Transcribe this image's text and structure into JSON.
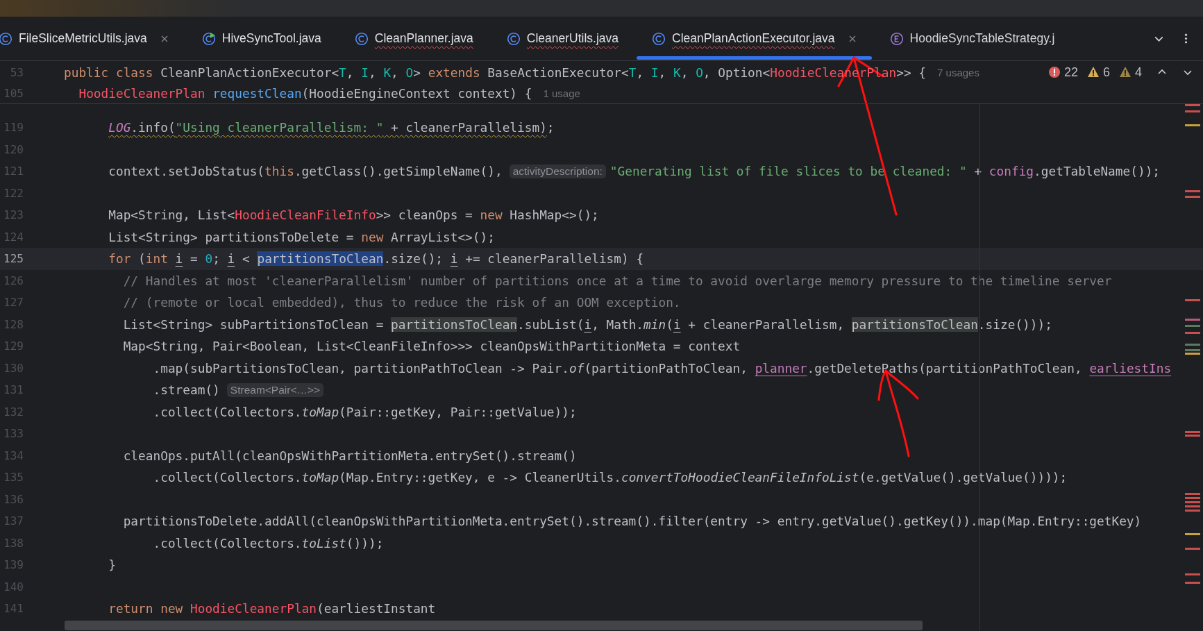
{
  "tabs": [
    {
      "label": "FileSliceMetricUtils.java",
      "kind": "class",
      "selected": false,
      "error": false,
      "closable": true
    },
    {
      "label": "HiveSyncTool.java",
      "kind": "runnable",
      "selected": false,
      "error": false,
      "closable": false
    },
    {
      "label": "CleanPlanner.java",
      "kind": "class",
      "selected": false,
      "error": true,
      "closable": false
    },
    {
      "label": "CleanerUtils.java",
      "kind": "class",
      "selected": false,
      "error": true,
      "closable": false
    },
    {
      "label": "CleanPlanActionExecutor.java",
      "kind": "class",
      "selected": true,
      "error": true,
      "closable": true
    },
    {
      "label": "HoodieSyncTableStrategy.j",
      "kind": "enum",
      "selected": false,
      "error": false,
      "closable": false
    }
  ],
  "inspections": [
    {
      "kind": "error",
      "count": "22"
    },
    {
      "kind": "warning",
      "count": "6"
    },
    {
      "kind": "weak",
      "count": "4"
    }
  ],
  "sticky": [
    {
      "n": "53",
      "parts": [
        {
          "kind": "code",
          "tokens": [
            {
              "t": "public class",
              "kind": "keyword"
            },
            {
              "t": " CleanPlanActionExecutor<",
              "kind": "plain"
            },
            {
              "t": "T",
              "kind": "typeparam"
            },
            {
              "t": ", ",
              "kind": "plain"
            },
            {
              "t": "I",
              "kind": "typeparam"
            },
            {
              "t": ", ",
              "kind": "plain"
            },
            {
              "t": "K",
              "kind": "typeparam"
            },
            {
              "t": ", ",
              "kind": "plain"
            },
            {
              "t": "O",
              "kind": "typeparam"
            },
            {
              "t": "> ",
              "kind": "plain"
            },
            {
              "t": "extends",
              "kind": "keyword"
            },
            {
              "t": " BaseActionExecutor<",
              "kind": "plain"
            },
            {
              "t": "T",
              "kind": "typeparam"
            },
            {
              "t": ", ",
              "kind": "plain"
            },
            {
              "t": "I",
              "kind": "typeparam"
            },
            {
              "t": ", ",
              "kind": "plain"
            },
            {
              "t": "K",
              "kind": "typeparam"
            },
            {
              "t": ", ",
              "kind": "plain"
            },
            {
              "t": "O",
              "kind": "typeparam"
            },
            {
              "t": ", Option<",
              "kind": "plain"
            },
            {
              "t": "HoodieCleanerPlan",
              "kind": "error"
            },
            {
              "t": ">> {",
              "kind": "plain"
            }
          ]
        },
        {
          "kind": "usages",
          "text": "7 usages"
        }
      ]
    },
    {
      "n": "105",
      "parts": [
        {
          "kind": "code",
          "tokens": [
            {
              "t": "  HoodieCleanerPlan",
              "kind": "error"
            },
            {
              "t": " requestClean",
              "kind": "method"
            },
            {
              "t": "(HoodieEngineContext context) {",
              "kind": "plain"
            }
          ]
        },
        {
          "kind": "usages",
          "text": "1 usage"
        }
      ]
    }
  ],
  "lines": [
    {
      "n": "119",
      "current": false,
      "parts": [
        {
          "kind": "code",
          "tokens": [
            {
              "t": "      LOG",
              "kind": "static-warn"
            },
            {
              "t": ".info(",
              "kind": "plain-warn"
            },
            {
              "t": "\"Using cleanerParallelism: \"",
              "kind": "string-warn"
            },
            {
              "t": " + cleanerParallelism)",
              "kind": "plain-warn"
            },
            {
              "t": ";",
              "kind": "plain"
            }
          ]
        }
      ]
    },
    {
      "n": "120",
      "current": false
    },
    {
      "n": "121",
      "current": false,
      "parts": [
        {
          "kind": "code",
          "tokens": [
            {
              "t": "      context.setJobStatus(",
              "kind": "plain"
            },
            {
              "t": "this",
              "kind": "keyword"
            },
            {
              "t": ".getClass().getSimpleName(),",
              "kind": "plain"
            }
          ]
        },
        {
          "kind": "inlay",
          "text": "activityDescription:"
        },
        {
          "kind": "code",
          "tokens": [
            {
              "t": "\"Generating list of file slices to be cleaned: \"",
              "kind": "string"
            },
            {
              "t": " + ",
              "kind": "plain"
            },
            {
              "t": "config",
              "kind": "field"
            },
            {
              "t": ".getTableName());",
              "kind": "plain"
            }
          ]
        }
      ]
    },
    {
      "n": "122",
      "current": false
    },
    {
      "n": "123",
      "current": false,
      "parts": [
        {
          "kind": "code",
          "tokens": [
            {
              "t": "      Map<String, List<",
              "kind": "plain"
            },
            {
              "t": "HoodieCleanFileInfo",
              "kind": "error"
            },
            {
              "t": ">> cleanOps = ",
              "kind": "plain"
            },
            {
              "t": "new",
              "kind": "keyword"
            },
            {
              "t": " HashMap<>();",
              "kind": "plain"
            }
          ]
        }
      ]
    },
    {
      "n": "124",
      "current": false,
      "parts": [
        {
          "kind": "code",
          "tokens": [
            {
              "t": "      List<String> partitionsToDelete = ",
              "kind": "plain"
            },
            {
              "t": "new",
              "kind": "keyword"
            },
            {
              "t": " ArrayList<>();",
              "kind": "plain"
            }
          ]
        }
      ]
    },
    {
      "n": "125",
      "current": true,
      "parts": [
        {
          "kind": "code",
          "tokens": [
            {
              "t": "      for",
              "kind": "keyword"
            },
            {
              "t": " (",
              "kind": "plain"
            },
            {
              "t": "int ",
              "kind": "keyword"
            },
            {
              "t": "i",
              "kind": "var"
            },
            {
              "t": " = ",
              "kind": "plain"
            },
            {
              "t": "0",
              "kind": "number"
            },
            {
              "t": "; ",
              "kind": "plain"
            },
            {
              "t": "i",
              "kind": "var"
            },
            {
              "t": " < ",
              "kind": "plain"
            },
            {
              "t": "partitionsToClean",
              "kind": "selection"
            },
            {
              "t": ".size(); ",
              "kind": "plain"
            },
            {
              "t": "i",
              "kind": "var"
            },
            {
              "t": " += cleanerParallelism) {",
              "kind": "plain"
            }
          ]
        }
      ]
    },
    {
      "n": "126",
      "current": false,
      "parts": [
        {
          "kind": "code",
          "tokens": [
            {
              "t": "        // Handles at most 'cleanerParallelism' number of partitions once at a time to avoid overlarge memory pressure to the timeline server",
              "kind": "comment"
            }
          ]
        }
      ]
    },
    {
      "n": "127",
      "current": false,
      "parts": [
        {
          "kind": "code",
          "tokens": [
            {
              "t": "        // (remote or local embedded), thus to reduce the risk of an OOM exception.",
              "kind": "comment"
            }
          ]
        }
      ]
    },
    {
      "n": "128",
      "current": false,
      "parts": [
        {
          "kind": "code",
          "tokens": [
            {
              "t": "        List<String> subPartitionsToClean = ",
              "kind": "plain"
            },
            {
              "t": "partitionsToClean",
              "kind": "occurrence"
            },
            {
              "t": ".subList(",
              "kind": "plain"
            },
            {
              "t": "i",
              "kind": "var"
            },
            {
              "t": ", Math.",
              "kind": "plain"
            },
            {
              "t": "min",
              "kind": "italic"
            },
            {
              "t": "(",
              "kind": "plain"
            },
            {
              "t": "i",
              "kind": "var"
            },
            {
              "t": " + cleanerParallelism, ",
              "kind": "plain"
            },
            {
              "t": "partitionsToClean",
              "kind": "occurrence"
            },
            {
              "t": ".size()));",
              "kind": "plain"
            }
          ]
        }
      ]
    },
    {
      "n": "129",
      "current": false,
      "parts": [
        {
          "kind": "code",
          "tokens": [
            {
              "t": "        Map<String, Pair<Boolean, List<CleanFileInfo>>> cleanOpsWithPartitionMeta = context",
              "kind": "plain"
            }
          ]
        }
      ]
    },
    {
      "n": "130",
      "current": false,
      "parts": [
        {
          "kind": "code",
          "tokens": [
            {
              "t": "            .map(subPartitionsToClean, partitionPathToClean -> Pair.",
              "kind": "plain"
            },
            {
              "t": "of",
              "kind": "italic"
            },
            {
              "t": "(partitionPathToClean, ",
              "kind": "plain"
            },
            {
              "t": "planner",
              "kind": "field-link"
            },
            {
              "t": ".getDeletePaths(partitionPathToClean, ",
              "kind": "plain"
            },
            {
              "t": "earliestIns",
              "kind": "field-link"
            }
          ]
        }
      ]
    },
    {
      "n": "131",
      "current": false,
      "parts": [
        {
          "kind": "code",
          "tokens": [
            {
              "t": "            .stream()",
              "kind": "plain"
            }
          ]
        },
        {
          "kind": "inlay",
          "text": "Stream<Pair<…>>"
        }
      ]
    },
    {
      "n": "132",
      "current": false,
      "parts": [
        {
          "kind": "code",
          "tokens": [
            {
              "t": "            .collect(Collectors.",
              "kind": "plain"
            },
            {
              "t": "toMap",
              "kind": "italic"
            },
            {
              "t": "(Pair::getKey, Pair::getValue));",
              "kind": "plain"
            }
          ]
        }
      ]
    },
    {
      "n": "133",
      "current": false
    },
    {
      "n": "134",
      "current": false,
      "parts": [
        {
          "kind": "code",
          "tokens": [
            {
              "t": "        cleanOps.putAll(cleanOpsWithPartitionMeta.entrySet().stream()",
              "kind": "plain"
            }
          ]
        }
      ]
    },
    {
      "n": "135",
      "current": false,
      "parts": [
        {
          "kind": "code",
          "tokens": [
            {
              "t": "            .collect(Collectors.",
              "kind": "plain"
            },
            {
              "t": "toMap",
              "kind": "italic"
            },
            {
              "t": "(Map.Entry::getKey, e -> CleanerUtils.",
              "kind": "plain"
            },
            {
              "t": "convertToHoodieCleanFileInfoList",
              "kind": "italic"
            },
            {
              "t": "(e.getValue().getValue())));",
              "kind": "plain"
            }
          ]
        }
      ]
    },
    {
      "n": "136",
      "current": false
    },
    {
      "n": "137",
      "current": false,
      "parts": [
        {
          "kind": "code",
          "tokens": [
            {
              "t": "        partitionsToDelete.addAll(cleanOpsWithPartitionMeta.entrySet().stream().filter(entry -> entry.getValue().getKey()).map(Map.Entry::getKey)",
              "kind": "plain"
            }
          ]
        }
      ]
    },
    {
      "n": "138",
      "current": false,
      "parts": [
        {
          "kind": "code",
          "tokens": [
            {
              "t": "            .collect(Collectors.",
              "kind": "plain"
            },
            {
              "t": "toList",
              "kind": "italic"
            },
            {
              "t": "()));",
              "kind": "plain"
            }
          ]
        }
      ]
    },
    {
      "n": "139",
      "current": false,
      "parts": [
        {
          "kind": "code",
          "tokens": [
            {
              "t": "      }",
              "kind": "plain"
            }
          ]
        }
      ]
    },
    {
      "n": "140",
      "current": false
    },
    {
      "n": "141",
      "current": false,
      "parts": [
        {
          "kind": "code",
          "tokens": [
            {
              "t": "      return new",
              "kind": "keyword"
            },
            {
              "t": " HoodieCleanerPlan",
              "kind": "error"
            },
            {
              "t": "(earliestInstant",
              "kind": "plain"
            }
          ]
        }
      ]
    }
  ],
  "annotations": [
    {
      "kind": "arrow"
    },
    {
      "kind": "arrow"
    }
  ]
}
